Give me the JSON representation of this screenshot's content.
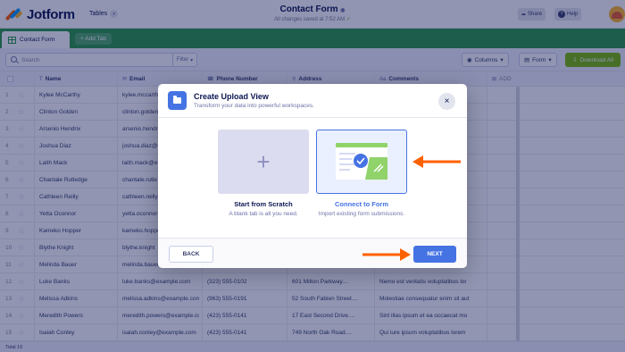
{
  "header": {
    "logo_text": "Jotform",
    "tables_label": "Tables",
    "form_title": "Contact Form",
    "save_status": "All changes saved at 7:52 AM",
    "share_label": "Share",
    "help_label": "Help"
  },
  "tabs": {
    "active_label": "Contact Form",
    "add_label": "+ Add Tab"
  },
  "toolbar": {
    "search_placeholder": "Search",
    "filter_label": "Filter",
    "columns_label": "Columns",
    "form_label": "Form",
    "download_label": "Download All"
  },
  "table": {
    "columns": [
      "Name",
      "Email",
      "Phone Number",
      "Address",
      "Comments"
    ],
    "add_column_label": "ADD",
    "rows": [
      {
        "num": "1",
        "name": "Kylee McCarthy",
        "email": "kylee.mccarth",
        "phone": "",
        "address": "",
        "comment": ""
      },
      {
        "num": "2",
        "name": "Clinton Golden",
        "email": "clinton.golden",
        "phone": "",
        "address": "",
        "comment": ""
      },
      {
        "num": "3",
        "name": "Arsenio Hendrix",
        "email": "arsenio.hendri",
        "phone": "",
        "address": "",
        "comment": ""
      },
      {
        "num": "4",
        "name": "Joshua Diaz",
        "email": "joshua.diaz@e",
        "phone": "",
        "address": "",
        "comment": ""
      },
      {
        "num": "5",
        "name": "Laith Mack",
        "email": "laith.mack@ex",
        "phone": "",
        "address": "",
        "comment": ""
      },
      {
        "num": "6",
        "name": "Chantale Rutledge",
        "email": "chantale.rutle",
        "phone": "",
        "address": "",
        "comment": ""
      },
      {
        "num": "7",
        "name": "Cathleen Reilly",
        "email": "cathleen.reilly",
        "phone": "",
        "address": "",
        "comment": ""
      },
      {
        "num": "8",
        "name": "Yetta Oconnor",
        "email": "yetta.oconnor",
        "phone": "",
        "address": "",
        "comment": ""
      },
      {
        "num": "9",
        "name": "Kameko Hopper",
        "email": "kameko.hoppe",
        "phone": "",
        "address": "",
        "comment": ""
      },
      {
        "num": "10",
        "name": "Blythe Knight",
        "email": "blythe.knight",
        "phone": "",
        "address": "",
        "comment": ""
      },
      {
        "num": "11",
        "name": "Melinda Bauer",
        "email": "melinda.bauer",
        "phone": "",
        "address": "",
        "comment": ""
      },
      {
        "num": "12",
        "name": "Luke Banks",
        "email": "luke.banks@example.com",
        "phone": "(323) 555-0102",
        "address": "601 Milton Parkway....",
        "comment": "Nemo est veritatis voluptatibus lor"
      },
      {
        "num": "13",
        "name": "Melissa Adkins",
        "email": "melissa.adkins@example.com",
        "phone": "(963) 555-0191",
        "address": "52 South Fabien Street....",
        "comment": "Molestiae consequatur enim sit aut"
      },
      {
        "num": "14",
        "name": "Meredith Powers",
        "email": "meredith.powers@example.com",
        "phone": "(423) 555-0141",
        "address": "17 East Second Drive....",
        "comment": "Sint illas ipsum et ea occaecat mo"
      },
      {
        "num": "15",
        "name": "Isaiah Conley",
        "email": "isaiah.conley@example.com",
        "phone": "(423) 555-0141",
        "address": "749 North Oak Road....",
        "comment": "Qui iure ipsum voluptatibus lorem"
      }
    ],
    "total_label": "Total 16"
  },
  "modal": {
    "title": "Create Upload View",
    "subtitle": "Transform your data into powerful workspaces.",
    "option_scratch_title": "Start from Scratch",
    "option_scratch_desc": "A blank tab is all you need.",
    "option_connect_title": "Connect to Form",
    "option_connect_desc": "Import existing form submissions.",
    "back_label": "BACK",
    "next_label": "NEXT"
  },
  "colors": {
    "primary_blue": "#4573e3",
    "tab_green": "#2b9a47",
    "download_green": "#78bb07",
    "annotation_orange": "#ff6100",
    "navy": "#0a1551"
  }
}
